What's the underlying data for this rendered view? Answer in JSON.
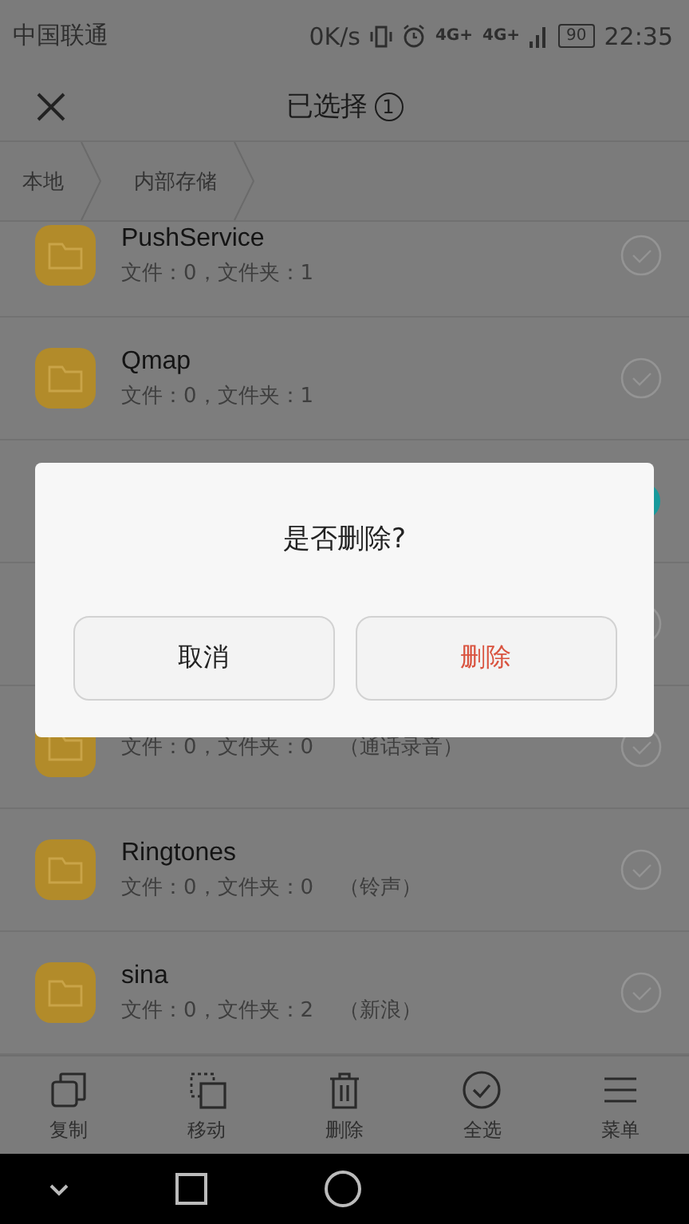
{
  "status_bar": {
    "carrier": "中国联通",
    "speed": "0K/s",
    "network": "4G+",
    "network_2": "4G+",
    "battery": "90",
    "time": "22:35"
  },
  "header": {
    "title": "已选择",
    "count": "1"
  },
  "breadcrumb": [
    "本地",
    "内部存储"
  ],
  "rows": [
    {
      "name": "PushService",
      "info": "文件：0，文件夹：1",
      "selected": false
    },
    {
      "name": "Qmap",
      "info": "文件：0，文件夹：1",
      "selected": false
    },
    {
      "selected": true
    },
    {
      "selected": false
    },
    {
      "info": "文件：0，文件夹：0",
      "note": "（通话录音）",
      "selected": false
    },
    {
      "name": "Ringtones",
      "info": "文件：0，文件夹：0",
      "note": "（铃声）",
      "selected": false
    },
    {
      "name": "sina",
      "info": "文件：0，文件夹：2",
      "note": "（新浪）",
      "selected": false
    }
  ],
  "toolbar": [
    {
      "kind": "copy",
      "label": "复制"
    },
    {
      "kind": "move",
      "label": "移动"
    },
    {
      "kind": "delete",
      "label": "删除"
    },
    {
      "kind": "select-all",
      "label": "全选"
    },
    {
      "kind": "menu",
      "label": "菜单"
    }
  ],
  "dialog": {
    "message": "是否删除?",
    "buttons": [
      {
        "label": "取消",
        "kind": "cancel"
      },
      {
        "label": "删除",
        "kind": "danger"
      }
    ]
  },
  "nav_bar": [
    {
      "kind": "down"
    },
    {
      "kind": "recent"
    },
    {
      "kind": "home"
    }
  ]
}
